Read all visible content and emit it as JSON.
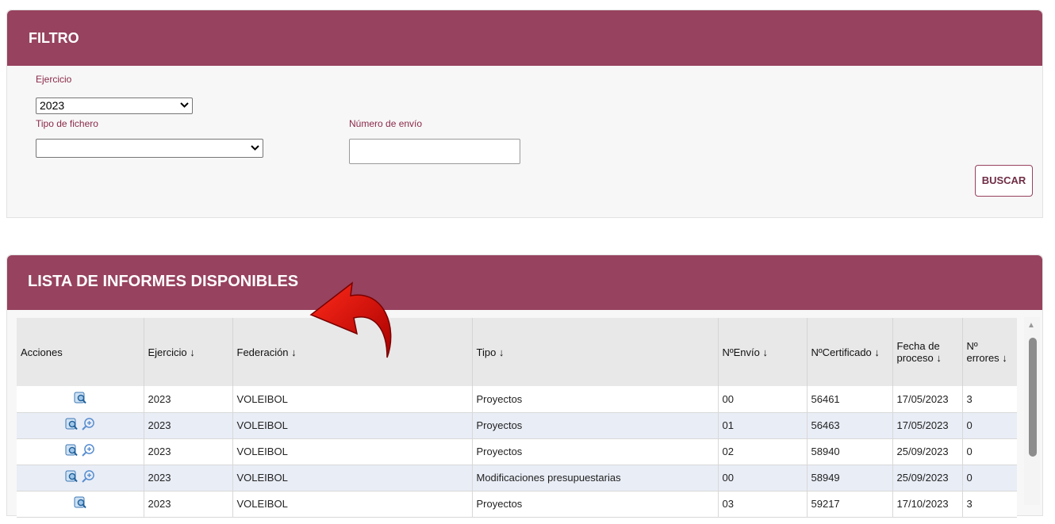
{
  "filtro": {
    "title": "FILTRO",
    "ejercicio_label": "Ejercicio",
    "ejercicio_value": "2023",
    "tipo_label": "Tipo de fichero",
    "tipo_value": "",
    "numero_label": "Número de envío",
    "numero_value": "",
    "buscar_label": "BUSCAR"
  },
  "lista": {
    "title": "LISTA DE INFORMES DISPONIBLES",
    "columns": [
      "Acciones",
      "Ejercicio ↓",
      "Federación ↓",
      "Tipo ↓",
      "NºEnvío ↓",
      "NºCertificado ↓",
      "Fecha de proceso ↓",
      "Nº errores ↓"
    ],
    "rows": [
      {
        "actions": [
          "view"
        ],
        "ejercicio": "2023",
        "federacion": "VOLEIBOL",
        "tipo": "Proyectos",
        "envio": "00",
        "certificado": "56461",
        "fecha": "17/05/2023",
        "errores": "3"
      },
      {
        "actions": [
          "view",
          "zoom"
        ],
        "ejercicio": "2023",
        "federacion": "VOLEIBOL",
        "tipo": "Proyectos",
        "envio": "01",
        "certificado": "56463",
        "fecha": "17/05/2023",
        "errores": "0"
      },
      {
        "actions": [
          "view",
          "zoom"
        ],
        "ejercicio": "2023",
        "federacion": "VOLEIBOL",
        "tipo": "Proyectos",
        "envio": "02",
        "certificado": "58940",
        "fecha": "25/09/2023",
        "errores": "0"
      },
      {
        "actions": [
          "view",
          "zoom"
        ],
        "ejercicio": "2023",
        "federacion": "VOLEIBOL",
        "tipo": "Modificaciones presupuestarias",
        "envio": "00",
        "certificado": "58949",
        "fecha": "25/09/2023",
        "errores": "0"
      },
      {
        "actions": [
          "view"
        ],
        "ejercicio": "2023",
        "federacion": "VOLEIBOL",
        "tipo": "Proyectos",
        "envio": "03",
        "certificado": "59217",
        "fecha": "17/10/2023",
        "errores": "3"
      }
    ]
  },
  "icons": {
    "view": "search-document-icon",
    "zoom": "zoom-in-icon",
    "annotation": "red-curved-arrow-icon"
  },
  "colors": {
    "header": "#97425e",
    "label": "#8a2a48",
    "alt_row": "#e9edf6"
  }
}
